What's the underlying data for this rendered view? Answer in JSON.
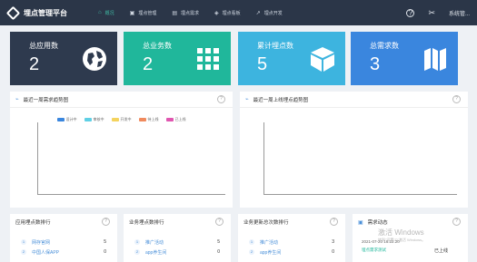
{
  "app": {
    "title": "埋点管理平台"
  },
  "nav": [
    {
      "label": "概况",
      "icon": "home-icon",
      "active": true
    },
    {
      "label": "埋点管理",
      "icon": "table-icon",
      "active": false
    },
    {
      "label": "埋点需求",
      "icon": "list-icon",
      "active": false
    },
    {
      "label": "埋点看板",
      "icon": "dashboard-icon",
      "active": false
    },
    {
      "label": "埋点开发",
      "icon": "code-icon",
      "active": false
    }
  ],
  "topright": {
    "user": "系统管..."
  },
  "cards": [
    {
      "title": "总应用数",
      "value": "2",
      "color": "#2e3a4e",
      "icon": "globe-icon"
    },
    {
      "title": "总业务数",
      "value": "2",
      "color": "#20b79b",
      "icon": "grid-icon"
    },
    {
      "title": "累计埋点数",
      "value": "5",
      "color": "#3db4df",
      "icon": "cube-icon"
    },
    {
      "title": "总需求数",
      "value": "3",
      "color": "#3a86de",
      "icon": "map-icon"
    }
  ],
  "chart_left": {
    "title": "最近一周需求趋势图",
    "chart_data": {
      "type": "line",
      "series": [
        {
          "name": "设计中",
          "color": "#3a86de",
          "values": []
        },
        {
          "name": "审核中",
          "color": "#5fd0e5",
          "values": []
        },
        {
          "name": "开发中",
          "color": "#f4d35e",
          "values": []
        },
        {
          "name": "待上线",
          "color": "#f08a5d",
          "values": []
        },
        {
          "name": "已上线",
          "color": "#e056b0",
          "values": []
        }
      ]
    }
  },
  "chart_right": {
    "title": "最近一周上线埋点趋势图",
    "chart_data": {
      "type": "line",
      "series": []
    }
  },
  "rank_app": {
    "title": "应用埋点数排行",
    "rows": [
      {
        "rank": "1",
        "name": "网存官网",
        "value": "5"
      },
      {
        "rank": "2",
        "name": "中国人保APP",
        "value": "0"
      }
    ]
  },
  "rank_biz": {
    "title": "业务埋点数排行",
    "rows": [
      {
        "rank": "1",
        "name": "推广活动",
        "value": "5"
      },
      {
        "rank": "2",
        "name": "app养生间",
        "value": "0"
      }
    ]
  },
  "rank_change": {
    "title": "业务更新总次数排行",
    "rows": [
      {
        "rank": "1",
        "name": "推广活动",
        "value": "3"
      },
      {
        "rank": "2",
        "name": "app养生间",
        "value": "0"
      }
    ]
  },
  "demand": {
    "title": "需求动态",
    "time": "2021-07-20 16:22:20",
    "name": "埋点需求测试",
    "status": "已上线"
  },
  "watermark": {
    "line1": "激活 Windows",
    "line2": "转到\"设置\"以激活 Windows。"
  }
}
